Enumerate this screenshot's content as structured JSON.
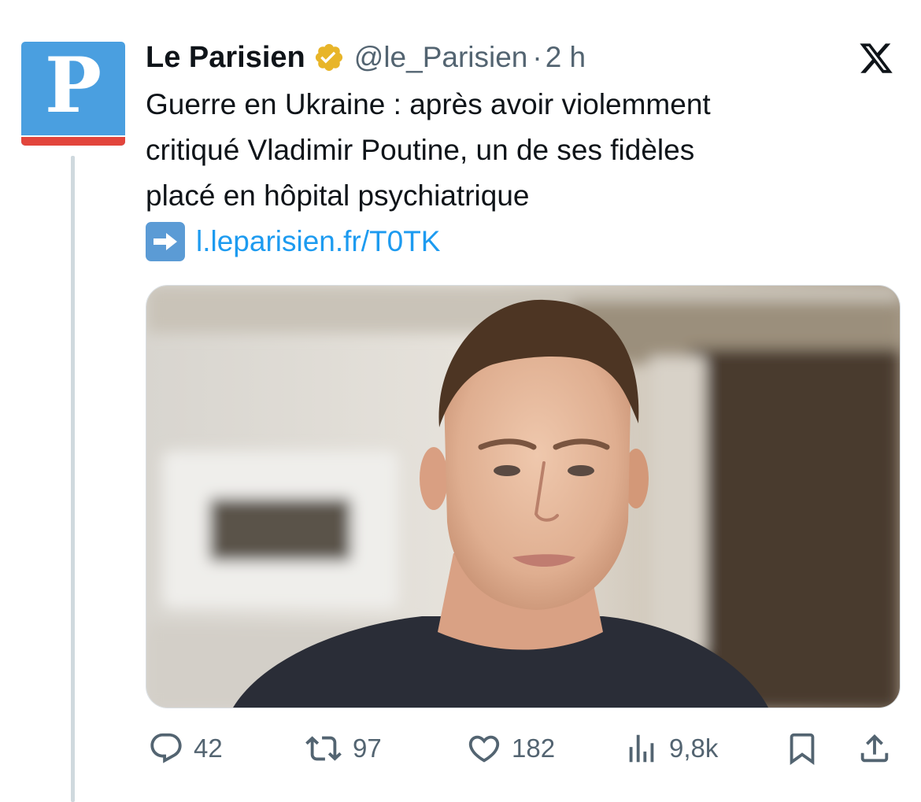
{
  "tweet": {
    "author": {
      "display_name": "Le Parisien",
      "handle": "@le_Parisien",
      "separator": "·",
      "time": "2 h",
      "avatar_letter": "P",
      "avatar_color": "#4a9fe0",
      "avatar_stripe_color": "#e2453c",
      "verified_badge_color": "#e8b529"
    },
    "text_lines": [
      "Guerre en Ukraine : après avoir violemment",
      "critiqué Vladimir Poutine, un de ses fidèles",
      "placé en hôpital psychiatrique"
    ],
    "link_emoji": "right-arrow-emoji",
    "link_text": "l.leparisien.fr/T0TK",
    "link_color": "#1d9bf0",
    "media": {
      "type": "photo",
      "icon": "photo-portrait"
    },
    "actions": {
      "replies": "42",
      "reposts": "97",
      "likes": "182",
      "views": "9,8k"
    }
  },
  "app": {
    "logo": "x-logo"
  }
}
